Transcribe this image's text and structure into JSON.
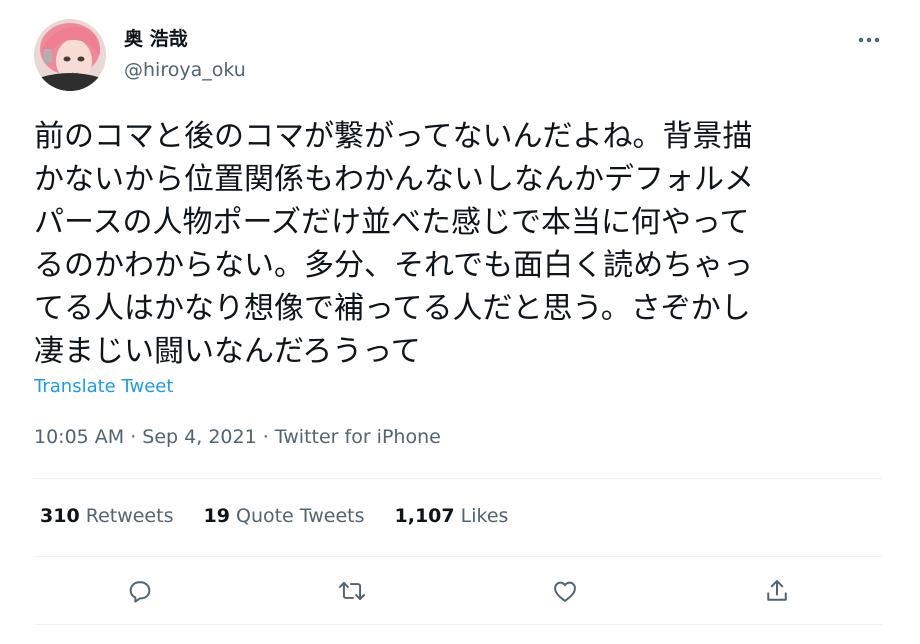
{
  "author": {
    "display_name": "奥 浩哉",
    "handle": "@hiroya_oku"
  },
  "tweet": {
    "text": "前のコマと後のコマが繋がってないんだよね。背景描\nかないから位置関係もわかんないしなんかデフォルメ\nパースの人物ポーズだけ並べた感じで本当に何やって\nるのかわからない。多分、それでも面白く読めちゃっ\nてる人はかなり想像で補ってる人だと思う。さぞかし\n凄まじい闘いなんだろうって",
    "translate_label": "Translate Tweet",
    "timestamp": "10:05 AM · Sep 4, 2021 · Twitter for iPhone"
  },
  "stats": {
    "retweets_count": "310",
    "retweets_label": "Retweets",
    "quotes_count": "19",
    "quotes_label": "Quote Tweets",
    "likes_count": "1,107",
    "likes_label": "Likes"
  },
  "icons": {
    "more": "more-icon",
    "reply": "reply-icon",
    "retweet": "retweet-icon",
    "like": "like-icon",
    "share": "share-icon"
  },
  "colors": {
    "link": "#1d9bf0",
    "secondary_text": "#536471",
    "primary_text": "#0f1419",
    "divider": "#eff3f4"
  }
}
